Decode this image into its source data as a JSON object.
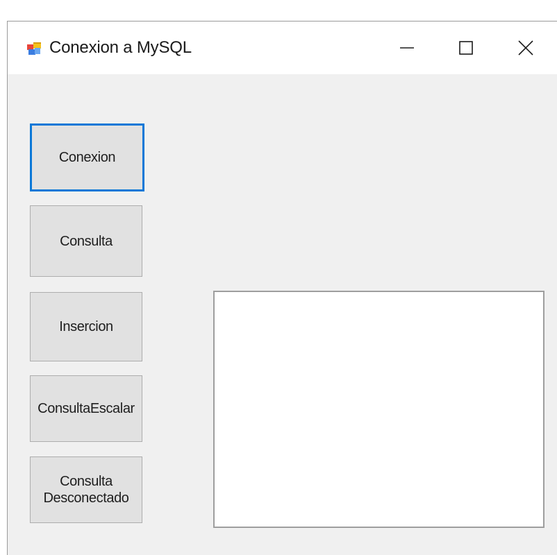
{
  "window": {
    "title": "Conexion a MySQL",
    "app_icon": "winforms-app-icon",
    "controls": {
      "minimize_icon": "minimize-icon",
      "maximize_icon": "maximize-icon",
      "close_icon": "close-icon"
    }
  },
  "buttons": [
    {
      "label": "Conexion",
      "focused": true
    },
    {
      "label": "Consulta",
      "focused": false
    },
    {
      "label": "Insercion",
      "focused": false
    },
    {
      "label": "ConsultaEscalar",
      "focused": false
    },
    {
      "label": "Consulta\nDesconectado",
      "focused": false
    }
  ],
  "listbox": {
    "items": []
  },
  "colors": {
    "focus_border": "#0a78d7",
    "button_face": "#e1e1e1",
    "form_background": "#f0f0f0"
  }
}
